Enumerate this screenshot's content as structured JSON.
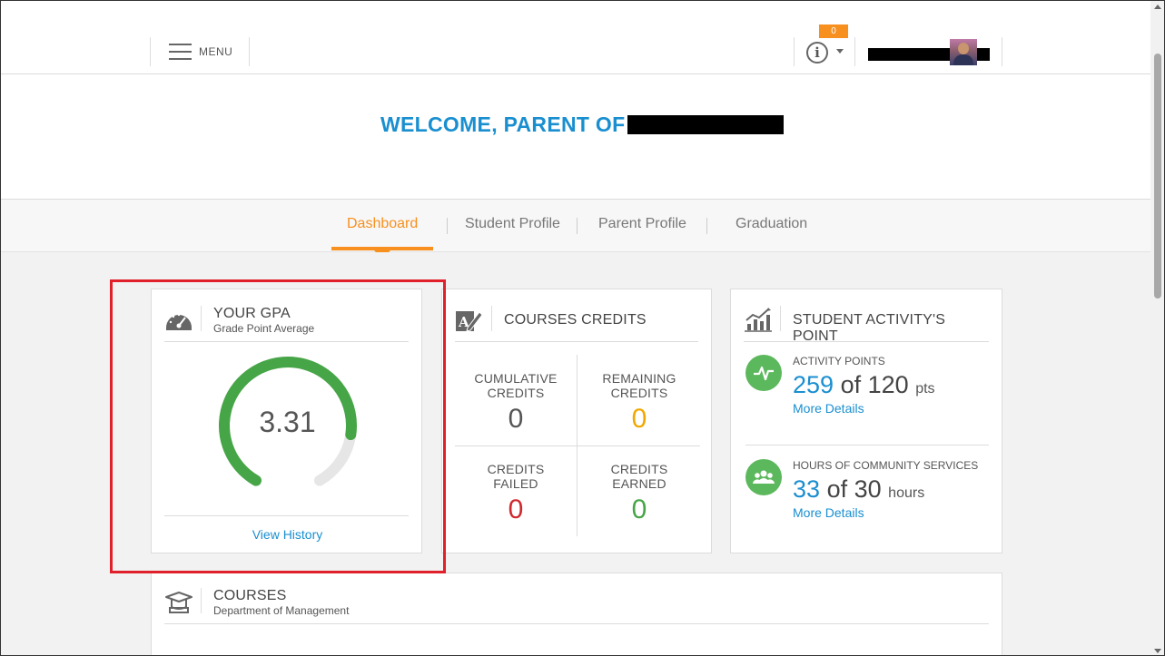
{
  "header": {
    "menu_label": "MENU",
    "notification_count": "0"
  },
  "welcome": {
    "title": "WELCOME, PARENT OF"
  },
  "tabs": [
    {
      "label": "Dashboard",
      "active": true
    },
    {
      "label": "Student Profile",
      "active": false
    },
    {
      "label": "Parent Profile",
      "active": false
    },
    {
      "label": "Graduation",
      "active": false
    }
  ],
  "gpa": {
    "title": "YOUR GPA",
    "subtitle": "Grade Point Average",
    "value": "3.31",
    "fraction_of_gauge": 0.8275,
    "link": "View History",
    "gauge_color": "#46a546"
  },
  "credits": {
    "title": "COURSES CREDITS",
    "items": [
      {
        "label_line1": "CUMULATIVE",
        "label_line2": "CREDITS",
        "value": "0",
        "color": "#555555"
      },
      {
        "label_line1": "REMAINING",
        "label_line2": "CREDITS",
        "value": "0",
        "color": "#f0a800"
      },
      {
        "label_line1": "CREDITS",
        "label_line2": "FAILED",
        "value": "0",
        "color": "#d0282e"
      },
      {
        "label_line1": "CREDITS",
        "label_line2": "EARNED",
        "value": "0",
        "color": "#46a546"
      }
    ]
  },
  "activity": {
    "title": "STUDENT ACTIVITY'S POINT",
    "points": {
      "label": "ACTIVITY POINTS",
      "current": "259",
      "of": "of",
      "total": "120",
      "unit": "pts",
      "more": "More Details"
    },
    "community": {
      "label": "HOURS OF COMMUNITY SERVICES",
      "current": "33",
      "of": "of",
      "total": "30",
      "unit": "hours",
      "more": "More Details"
    }
  },
  "courses": {
    "title": "COURSES",
    "subtitle": "Department of Management"
  }
}
